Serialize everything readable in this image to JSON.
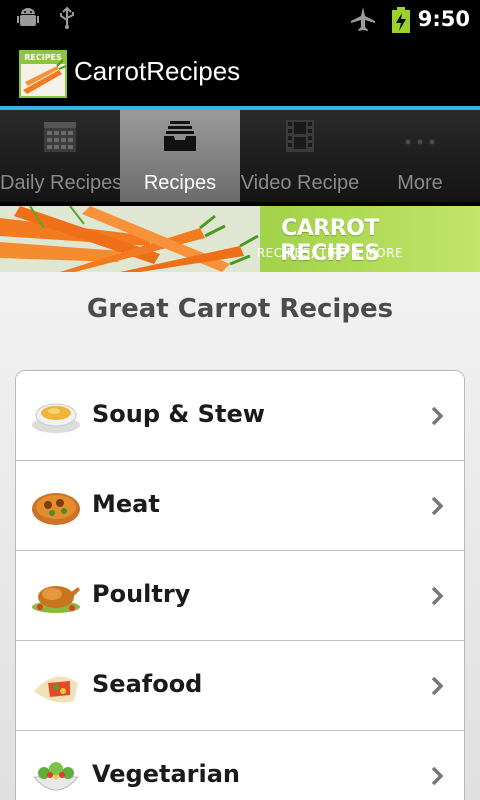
{
  "status_bar": {
    "time": "9:50",
    "icons": [
      "android-debug-icon",
      "usb-icon",
      "airplane-mode-icon",
      "battery-charging-icon"
    ]
  },
  "action_bar": {
    "app_icon_text": "RECIPES",
    "title": "CarrotRecipes"
  },
  "tabs": [
    {
      "label": "Daily Recipes",
      "icon": "calendar-icon",
      "selected": false
    },
    {
      "label": "Recipes",
      "icon": "inbox-tray-icon",
      "selected": true
    },
    {
      "label": "Video Recipe",
      "icon": "film-icon",
      "selected": false
    },
    {
      "label": "More",
      "icon": "more-dots-icon",
      "selected": false
    }
  ],
  "banner": {
    "title": "CARROT RECIPES",
    "subtitle": "RECIPES, TIPS & MORE"
  },
  "main": {
    "title": "Great Carrot Recipes",
    "categories": [
      {
        "label": "Soup & Stew",
        "icon": "soup-bowl-icon"
      },
      {
        "label": "Meat",
        "icon": "meat-dish-icon"
      },
      {
        "label": "Poultry",
        "icon": "roast-chicken-icon"
      },
      {
        "label": "Seafood",
        "icon": "wrap-icon"
      },
      {
        "label": "Vegetarian",
        "icon": "salad-bowl-icon"
      }
    ]
  },
  "colors": {
    "accent": "#34b5e5",
    "banner_green": "#8cc63f",
    "carrot_orange": "#f47a20"
  }
}
